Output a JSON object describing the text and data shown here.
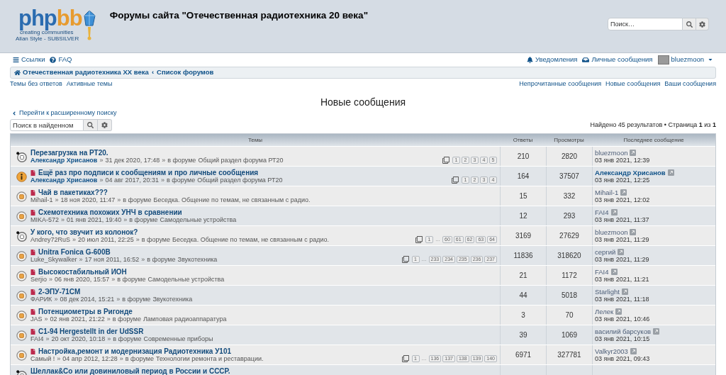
{
  "logo": {
    "word": "php",
    "word_accent": "bb",
    "tagline": "creating communities",
    "subtitle": "Allan Style - SUBSILVER"
  },
  "site_title": "Форумы сайта \"Отечественная радиотехника 20 века\"",
  "header_search": {
    "placeholder": "Поиск…"
  },
  "nav": {
    "left": [
      {
        "kind": "menu",
        "label": "Ссылки"
      },
      {
        "kind": "faq",
        "label": "FAQ"
      }
    ],
    "right": [
      {
        "kind": "bell",
        "label": "Уведомления"
      },
      {
        "kind": "inbox",
        "label": "Личные сообщения"
      },
      {
        "kind": "user",
        "label": "bluezmoon"
      }
    ]
  },
  "breadcrumbs": {
    "items": [
      "Отечественная радиотехника XX века",
      "Список форумов"
    ],
    "separator": "‹"
  },
  "quick_links": {
    "left": [
      "Темы без ответов",
      "Активные темы"
    ],
    "right": [
      "Непрочитанные сообщения",
      "Новые сообщения",
      "Ваши сообщения"
    ]
  },
  "heading": "Новые сообщения",
  "back_link": "Перейти к расширенному поиску",
  "results_search": {
    "placeholder": "Поиск в найденном"
  },
  "results_summary": "Найдено 45 результатов • Страница **1** из **1**",
  "table": {
    "columns": [
      "Темы",
      "Ответы",
      "Просмотры",
      "Последнее сообщение"
    ],
    "rows": [
      {
        "kind": "mine",
        "new": false,
        "title": "Перезагрузка на РТ20.",
        "author": {
          "name": "Александр Хрисанов",
          "highlighted": true
        },
        "seps": [
          "»",
          "»"
        ],
        "date": "31 дек 2020, 17:48",
        "forum_prefix": "в форуме",
        "forum": "Общий раздел форума РТ20",
        "pages": [
          {
            "kind": "page",
            "label": "1"
          },
          {
            "kind": "page",
            "label": "2"
          },
          {
            "kind": "page",
            "label": "3"
          },
          {
            "kind": "page",
            "label": "4"
          },
          {
            "kind": "page",
            "label": "5"
          }
        ],
        "replies": "210",
        "views": "2820",
        "last": {
          "name": "bluezmoon",
          "highlighted": false,
          "date": "03 янв 2021, 12:39"
        }
      },
      {
        "kind": "announcement",
        "new": true,
        "title": "Ещё раз про подписи к сообщениям и про личные сообщения",
        "author": {
          "name": "Александр Хрисанов",
          "highlighted": true
        },
        "seps": [
          "»",
          "»"
        ],
        "date": "04 авг 2017, 20:31",
        "forum_prefix": "в форуме",
        "forum": "Общий раздел форума РТ20",
        "pages": [
          {
            "kind": "page",
            "label": "1"
          },
          {
            "kind": "page",
            "label": "2"
          },
          {
            "kind": "page",
            "label": "3"
          },
          {
            "kind": "page",
            "label": "4"
          }
        ],
        "replies": "164",
        "views": "37507",
        "last": {
          "name": "Александр Хрисанов",
          "highlighted": true,
          "date": "03 янв 2021, 12:25"
        }
      },
      {
        "kind": "unread",
        "new": true,
        "title": "Чай в пакетиках???",
        "author": {
          "name": "Mihail-1",
          "highlighted": false
        },
        "seps": [
          "»",
          "»"
        ],
        "date": "18 ноя 2020, 11:47",
        "forum_prefix": "в форуме",
        "forum": "Беседка. Общение по темам, не связанным с радио.",
        "replies": "15",
        "views": "332",
        "last": {
          "name": "Mihail-1",
          "highlighted": false,
          "date": "03 янв 2021, 12:02"
        }
      },
      {
        "kind": "unread",
        "new": true,
        "title": "Схемотехника похожих УНЧ в сравнении",
        "author": {
          "name": "MIKA-572",
          "highlighted": false
        },
        "seps": [
          "»",
          "»"
        ],
        "date": "01 янв 2021, 19:40",
        "forum_prefix": "в форуме",
        "forum": "Самодельные устройства",
        "replies": "12",
        "views": "293",
        "last": {
          "name": "FAI4",
          "highlighted": false,
          "date": "03 янв 2021, 11:37"
        }
      },
      {
        "kind": "mine",
        "new": false,
        "title": "У кого, что звучит из колонок?",
        "author": {
          "name": "Andrey72RuS",
          "highlighted": false
        },
        "seps": [
          "»",
          "»"
        ],
        "date": "20 июл 2011, 22:25",
        "forum_prefix": "в форуме",
        "forum": "Беседка. Общение по темам, не связанным с радио.",
        "pages": [
          {
            "kind": "page",
            "label": "1"
          },
          {
            "kind": "gap",
            "label": "…"
          },
          {
            "kind": "page",
            "label": "60"
          },
          {
            "kind": "page",
            "label": "61"
          },
          {
            "kind": "page",
            "label": "62"
          },
          {
            "kind": "page",
            "label": "63"
          },
          {
            "kind": "page",
            "label": "64"
          }
        ],
        "replies": "3169",
        "views": "27629",
        "last": {
          "name": "bluezmoon",
          "highlighted": false,
          "date": "03 янв 2021, 11:29"
        }
      },
      {
        "kind": "unread",
        "new": true,
        "title": "Unitra Fonica G-600B",
        "author": {
          "name": "Luke_Skywalker",
          "highlighted": false
        },
        "seps": [
          "»",
          "»"
        ],
        "date": "17 ноя 2011, 16:52",
        "forum_prefix": "в форуме",
        "forum": "Звукотехника",
        "pages": [
          {
            "kind": "page",
            "label": "1"
          },
          {
            "kind": "gap",
            "label": "…"
          },
          {
            "kind": "page",
            "label": "233"
          },
          {
            "kind": "page",
            "label": "234"
          },
          {
            "kind": "page",
            "label": "235"
          },
          {
            "kind": "page",
            "label": "236"
          },
          {
            "kind": "page",
            "label": "237"
          }
        ],
        "replies": "11836",
        "views": "318620",
        "last": {
          "name": "сергий",
          "highlighted": false,
          "date": "03 янв 2021, 11:29"
        }
      },
      {
        "kind": "unread",
        "new": true,
        "title": "Высокостабильный ИОН",
        "author": {
          "name": "Serjio",
          "highlighted": false
        },
        "seps": [
          "»",
          "»"
        ],
        "date": "06 янв 2020, 15:57",
        "forum_prefix": "в форуме",
        "forum": "Самодельные устройства",
        "replies": "21",
        "views": "1172",
        "last": {
          "name": "FAI4",
          "highlighted": false,
          "date": "03 янв 2021, 11:21"
        }
      },
      {
        "kind": "unread",
        "new": true,
        "title": "2-ЭПУ-71СМ",
        "author": {
          "name": "ФАРИК",
          "highlighted": false
        },
        "seps": [
          "»",
          "»"
        ],
        "date": "08 дек 2014, 15:21",
        "forum_prefix": "в форуме",
        "forum": "Звукотехника",
        "replies": "44",
        "views": "5018",
        "last": {
          "name": "Starlight",
          "highlighted": false,
          "date": "03 янв 2021, 11:18"
        }
      },
      {
        "kind": "unread",
        "new": true,
        "title": "Потенциометры в Ригонде",
        "author": {
          "name": "JAS",
          "highlighted": false
        },
        "seps": [
          "»",
          "»"
        ],
        "date": "02 янв 2021, 21:22",
        "forum_prefix": "в форуме",
        "forum": "Ламповая радиоаппаратура",
        "replies": "3",
        "views": "70",
        "last": {
          "name": "Лелек",
          "highlighted": false,
          "date": "03 янв 2021, 10:46"
        }
      },
      {
        "kind": "unread",
        "new": true,
        "title": "C1-94 Hergestellt in der UdSSR",
        "author": {
          "name": "FAI4",
          "highlighted": false
        },
        "seps": [
          "»",
          "»"
        ],
        "date": "20 окт 2020, 10:18",
        "forum_prefix": "в форуме",
        "forum": "Современные приборы",
        "replies": "39",
        "views": "1069",
        "last": {
          "name": "василий барсуков",
          "highlighted": false,
          "date": "03 янв 2021, 10:15"
        }
      },
      {
        "kind": "unread",
        "new": true,
        "title": "Настройка,ремонт и модернизация Радиотехника У101",
        "author": {
          "name": "Самый !",
          "highlighted": false
        },
        "seps": [
          "»",
          "»"
        ],
        "date": "04 апр 2012, 12:28",
        "forum_prefix": "в форуме",
        "forum": "Технологии ремонта и реставрации.",
        "pages": [
          {
            "kind": "page",
            "label": "1"
          },
          {
            "kind": "gap",
            "label": "…"
          },
          {
            "kind": "page",
            "label": "136"
          },
          {
            "kind": "page",
            "label": "137"
          },
          {
            "kind": "page",
            "label": "138"
          },
          {
            "kind": "page",
            "label": "139"
          },
          {
            "kind": "page",
            "label": "140"
          }
        ],
        "replies": "6971",
        "views": "327781",
        "last": {
          "name": "Valkyr2003",
          "highlighted": false,
          "date": "03 янв 2021, 09:43"
        }
      },
      {
        "kind": "mine",
        "new": false,
        "title": "Шеллак&Co или довиниловый период в России и СССР."
      }
    ]
  }
}
